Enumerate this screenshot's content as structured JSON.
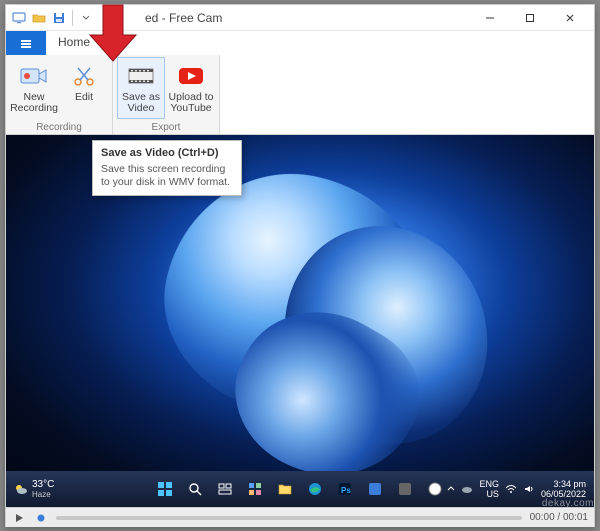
{
  "window": {
    "title_suffix": "ed - Free Cam"
  },
  "tabs": {
    "home": "Home"
  },
  "ribbon": {
    "recording_group": "Recording",
    "export_group": "Export",
    "new_recording": "New\nRecording",
    "edit": "Edit",
    "save_as_video": "Save as\nVideo",
    "upload_youtube": "Upload to\nYouTube"
  },
  "tooltip": {
    "title": "Save as Video (Ctrl+D)",
    "body": "Save this screen recording to your disk in WMV format."
  },
  "taskbar": {
    "weather_temp": "33°C",
    "weather_label": "Haze",
    "lang": "ENG",
    "region": "US",
    "time": "3:34 pm",
    "date": "06/05/2022"
  },
  "player": {
    "time": "00:00 / 00:01"
  },
  "watermark": "dekay.com"
}
